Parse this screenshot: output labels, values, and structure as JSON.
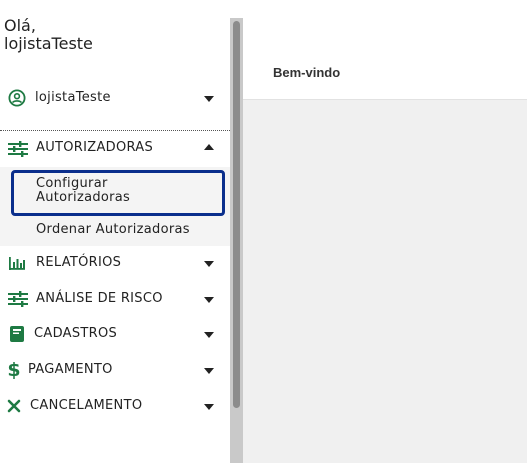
{
  "sidebar": {
    "greeting": "Olá,",
    "username": "lojistaTeste",
    "user_menu_label": "lojistaTeste",
    "menu": {
      "autorizadoras": "AUTORIZADORAS",
      "sub_configurar_line1": "Configurar",
      "sub_configurar_line2": "Autorizadoras",
      "sub_ordenar": "Ordenar Autorizadoras",
      "relatorios": "RELATÓRIOS",
      "analise_risco": "ANÁLISE DE RISCO",
      "cadastros": "CADASTROS",
      "pagamento": "PAGAMENTO",
      "cancelamento": "CANCELAMENTO"
    }
  },
  "main": {
    "title": "Bem-vindo"
  },
  "colors": {
    "icon_green": "#1e7a43",
    "highlight_border": "#0a2e8c"
  }
}
